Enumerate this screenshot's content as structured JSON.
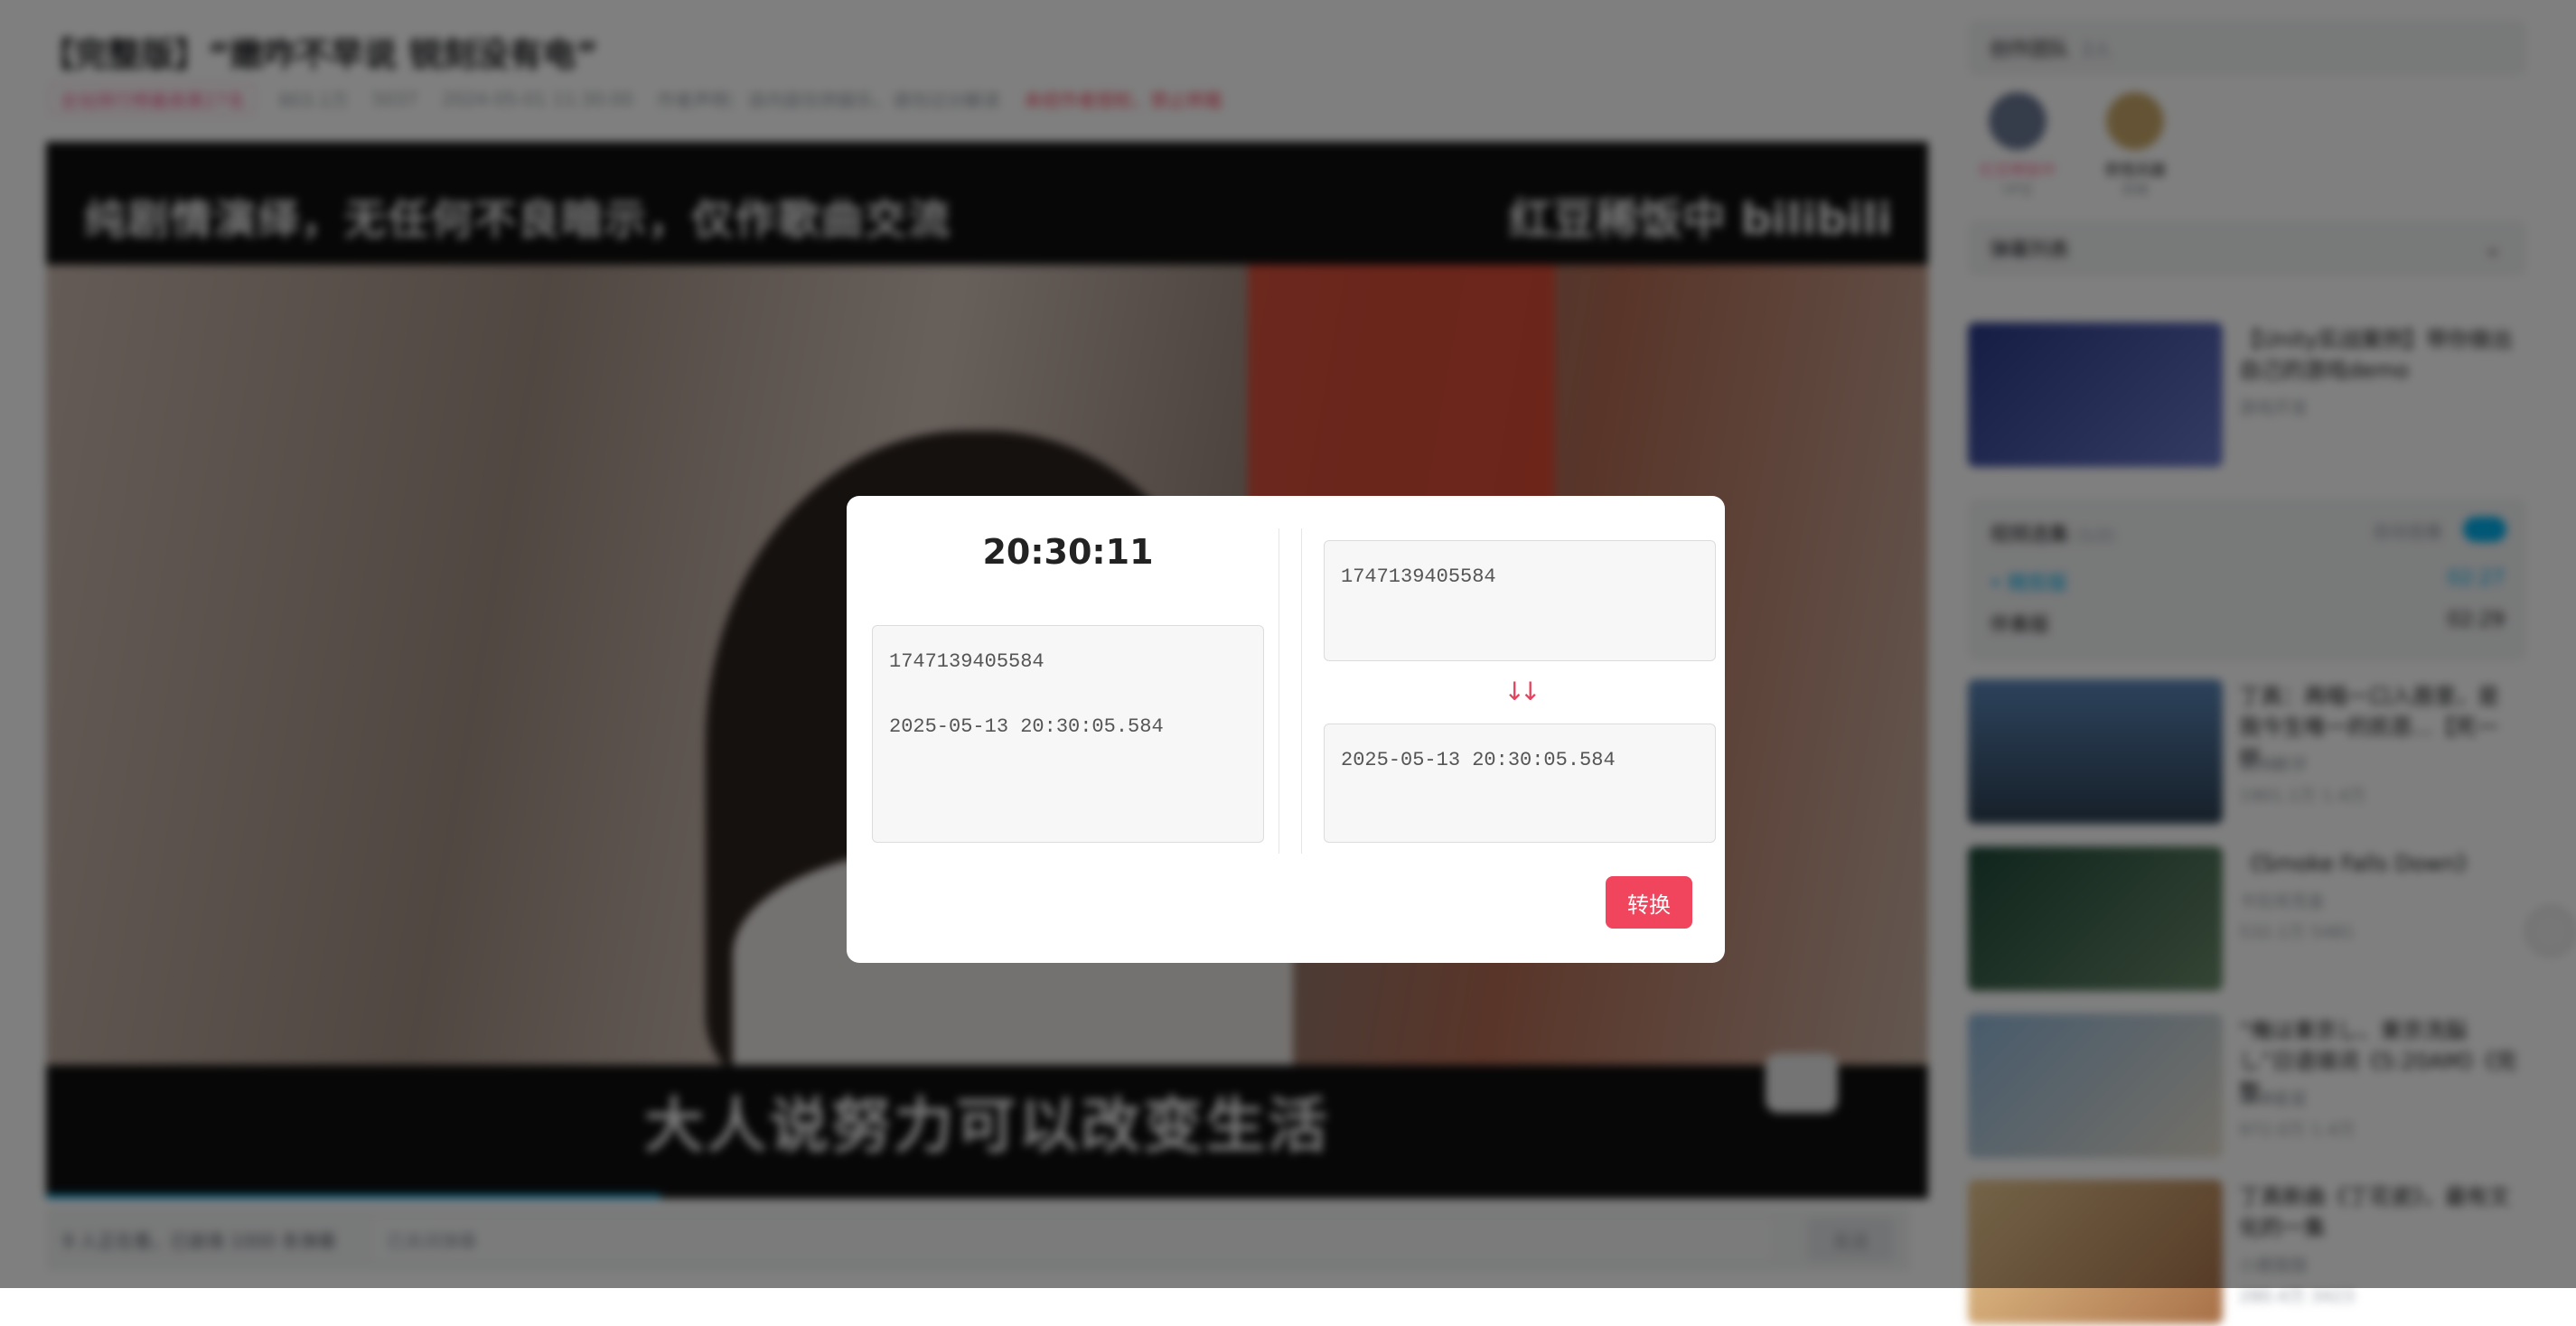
{
  "video": {
    "title": "【完整版】“嫩咋不早说 锐刻没有电”",
    "rank_badge": "全站排行榜最高第27名",
    "views": "803.1万",
    "danmaku_count": "5037",
    "publish_time": "2024-05-01 11:30:00",
    "notice": "作者声明：该内容仅供娱乐，请勿过分解读",
    "no_repost": "未经作者授权，禁止转载",
    "caption_top": "纯剧情演绎，无任何不良暗示，仅作歌曲交流",
    "caption_logo": "红豆稀饭中 bilibili",
    "caption_bottom": "大人说努力可以改变生活"
  },
  "danmaku_bar": {
    "watching": "9 人正在看，已装填 1000 条弹幕",
    "input_placeholder": "已关闭弹幕",
    "send_label": "发送"
  },
  "sidebar": {
    "team_title": "创作团队",
    "team_count": "2人",
    "creators": [
      {
        "name": "红豆稀饭中",
        "role": "UP主"
      },
      {
        "name": "奇怪兵器",
        "role": "剪辑"
      }
    ],
    "list_title": "弹幕列表",
    "ad": {
      "title": "【Unity实战案例】带你做出自己的游戏demo",
      "meta": "游戏开发"
    },
    "playlist": {
      "title": "视频选集",
      "count": "(1/2)",
      "autoplay_label": "自动连播",
      "items": [
        {
          "label": "•  精剪版",
          "duration": "02:27"
        },
        {
          "label": "伴奏版",
          "duration": "02:29"
        }
      ]
    },
    "recommendations": [
      {
        "title": "丁真：再唱一口入唇里，是我今生唯一的凯恩...【死一样...",
        "up": "清风数学",
        "stats": "1901.1万   1.4万",
        "duration": "04:29"
      },
      {
        "title": "《Smoke Falls Down》",
        "up": "卡拉肖克金",
        "stats": "532.1万   5481",
        "duration": ""
      },
      {
        "title": "“俺は東京し、東京洗脳し”日语填词《5:20AM》《完整...",
        "up": "东洋星星",
        "stats": "972.0万   1.4万",
        "duration": "02:38"
      },
      {
        "title": "丁真新曲《丁花瓷》，最有文化的一集",
        "up": "小鹿鼓鼓",
        "stats": "280.4万   3423",
        "duration": ""
      }
    ]
  },
  "modal": {
    "clock": "20:30:11",
    "left_text": "1747139405584\n\n2025-05-13 20:30:05.584",
    "input_value": "1747139405584",
    "arrows": "↓↓",
    "output_value": "2025-05-13 20:30:05.584",
    "convert_label": "转换"
  },
  "colors": {
    "accent": "#f0455d",
    "bili_blue": "#00aeec",
    "overlay": "rgba(0,0,0,0.5)"
  }
}
